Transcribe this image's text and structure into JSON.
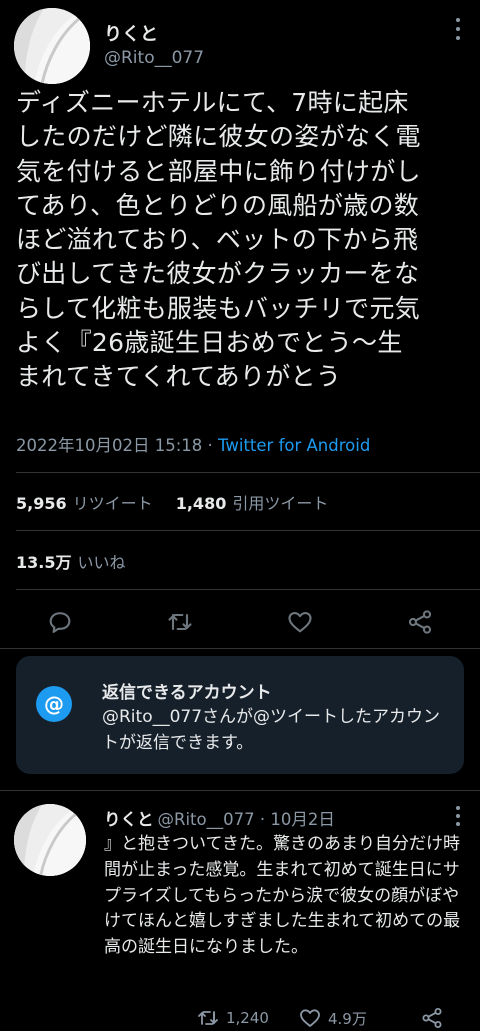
{
  "tweet": {
    "author_name": "りくと",
    "author_handle": "@Rito__077",
    "text_lines": [
      "ディズニーホテルにて、7時に起床",
      "したのだけど隣に彼女の姿がなく電",
      "気を付けると部屋中に飾り付けがし",
      "てあり、色とりどりの風船が歳の数",
      "ほど溢れており、ベットの下から飛",
      "び出してきた彼女がクラッカーをな",
      "らして化粧も服装もバッチリで元気",
      "よく『26歳誕生日おめでとう〜生",
      "まれてきてくれてありがとう"
    ],
    "timestamp": "2022年10月02日 15:18",
    "separator": " · ",
    "source": "Twitter for Android"
  },
  "stats": {
    "retweets_count": "5,956",
    "retweets_label": "リツイート",
    "quotes_count": "1,480",
    "quotes_label": "引用ツイート",
    "likes_count": "13.5万",
    "likes_label": "いいね"
  },
  "reply_notice": {
    "icon_glyph": "@",
    "title": "返信できるアカウント",
    "description": "@Rito__077さんが@ツイートしたアカウントが返信できます。"
  },
  "reply": {
    "author_name": "りくと",
    "meta": "@Rito__077 · 10月2日",
    "text": "』と抱きついてきた。驚きのあまり自分だけ時間が止まった感覚。生まれて初めて誕生日にサプライズしてもらったから涙で彼女の顔がぼやけてほんと嬉しすぎました生まれて初めての最高の誕生日になりました。",
    "retweet_count": "1,240",
    "like_count": "4.9万"
  },
  "icons": {
    "reply": "comment-icon",
    "retweet": "retweet-icon",
    "like": "heart-icon",
    "share": "share-icon"
  },
  "colors": {
    "background": "#000000",
    "accent": "#1d9bf0",
    "muted": "#8b98a5",
    "card": "#16202b"
  }
}
